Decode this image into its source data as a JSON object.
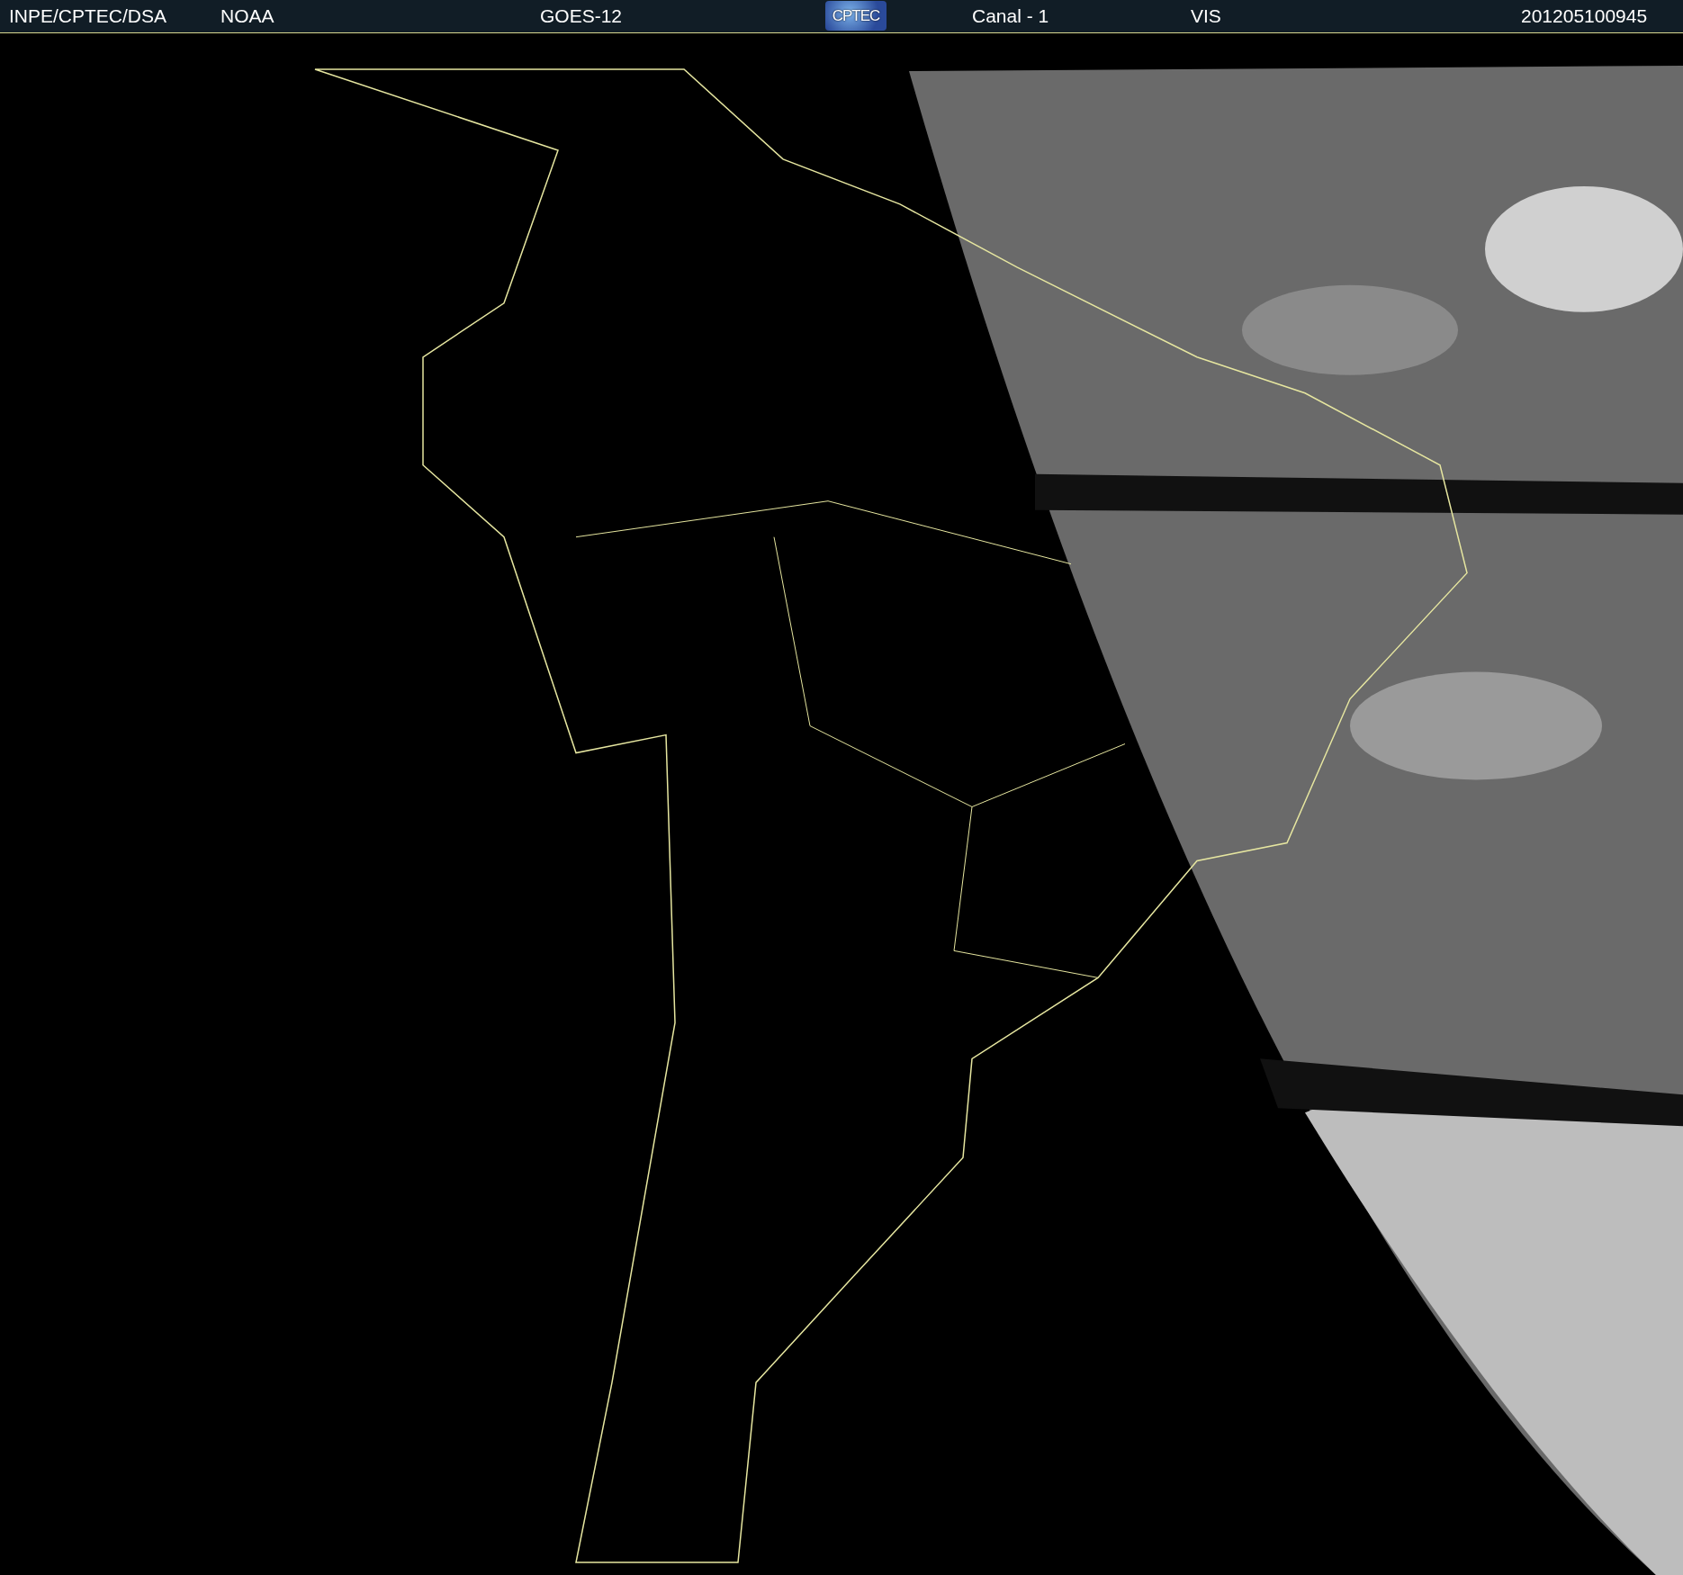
{
  "header": {
    "source": "INPE/CPTEC/DSA",
    "agency": "NOAA",
    "satellite": "GOES-12",
    "logo": "CPTEC",
    "channel": "Canal - 1",
    "band": "VIS",
    "timestamp": "201205100945"
  }
}
